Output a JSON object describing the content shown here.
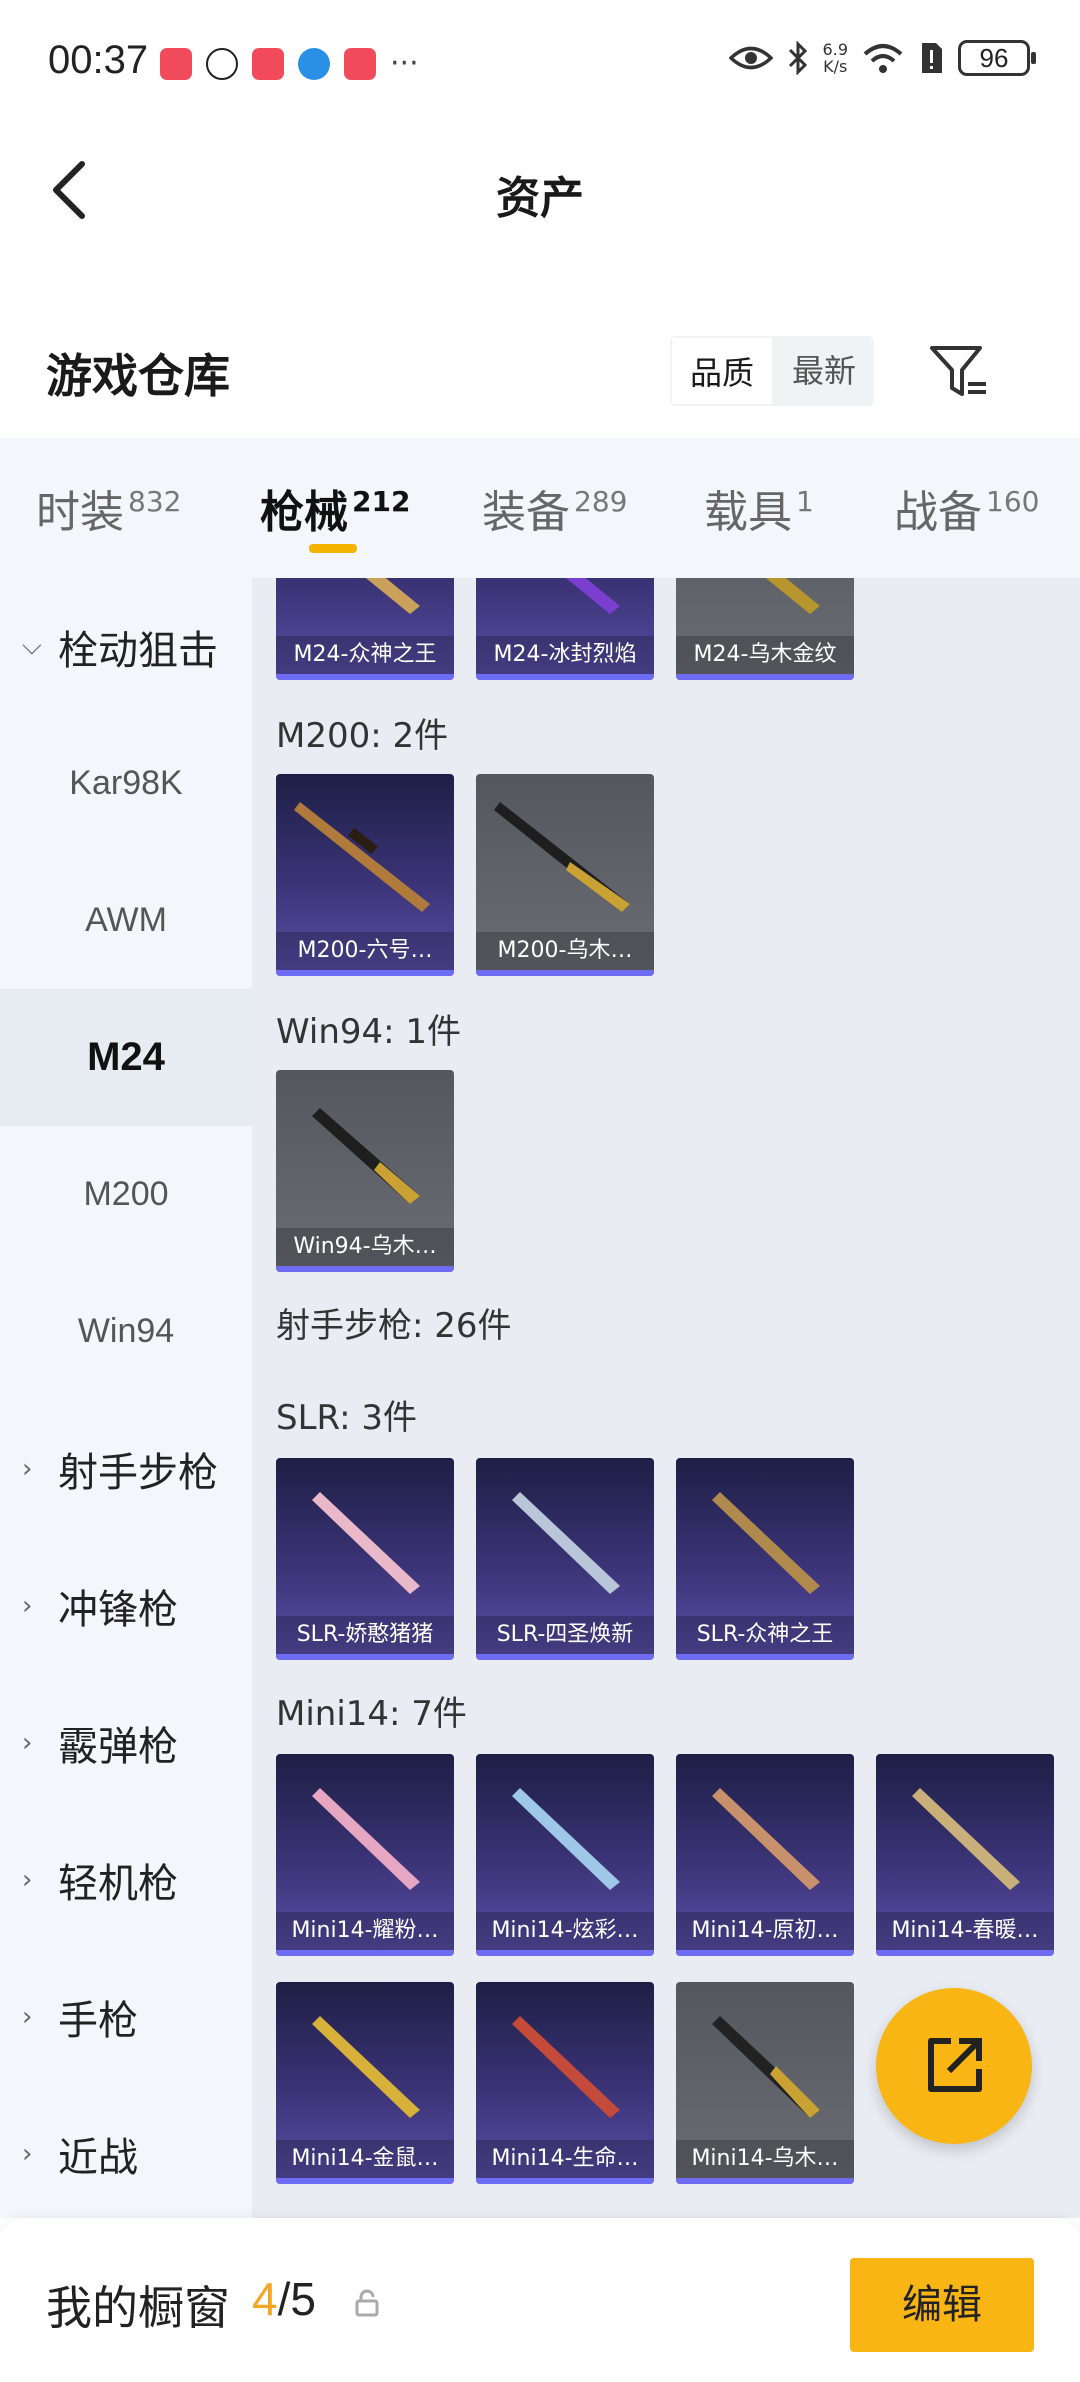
{
  "status_bar": {
    "time": "00:37",
    "more": "···",
    "speed_top": "6.9",
    "speed_bottom": "K/s",
    "battery": "96"
  },
  "header": {
    "title": "资产"
  },
  "warehouse": {
    "title": "游戏仓库",
    "sort_options": [
      "品质",
      "最新"
    ]
  },
  "category_tabs": [
    {
      "label": "时装",
      "count": "832"
    },
    {
      "label": "枪械",
      "count": "212"
    },
    {
      "label": "装备",
      "count": "289"
    },
    {
      "label": "载具",
      "count": "1"
    },
    {
      "label": "战备",
      "count": "160"
    }
  ],
  "sidebar": {
    "items": [
      {
        "label": "栓动狙击",
        "type": "group",
        "expanded": true
      },
      {
        "label": "Kar98K",
        "type": "sub"
      },
      {
        "label": "AWM",
        "type": "sub"
      },
      {
        "label": "M24",
        "type": "sub",
        "active": true
      },
      {
        "label": "M200",
        "type": "sub"
      },
      {
        "label": "Win94",
        "type": "sub"
      },
      {
        "label": "射手步枪",
        "type": "group"
      },
      {
        "label": "冲锋枪",
        "type": "group"
      },
      {
        "label": "霰弹枪",
        "type": "group"
      },
      {
        "label": "轻机枪",
        "type": "group"
      },
      {
        "label": "手枪",
        "type": "group"
      },
      {
        "label": "近战",
        "type": "group"
      }
    ]
  },
  "content": {
    "top_cards": [
      "M24-众神之王",
      "M24-冰封烈焰",
      "M24-乌木金纹"
    ],
    "sections": [
      {
        "label": "M200: 2件",
        "cards": [
          "M200-六号…",
          "M200-乌木…"
        ]
      },
      {
        "label": "Win94: 1件",
        "cards": [
          "Win94-乌木…"
        ]
      },
      {
        "label": "射手步枪: 26件"
      },
      {
        "label": "SLR: 3件",
        "cards": [
          "SLR-娇憨猪猪",
          "SLR-四圣焕新",
          "SLR-众神之王"
        ]
      },
      {
        "label": "Mini14: 7件",
        "cards": [
          "Mini14-耀粉…",
          "Mini14-炫彩…",
          "Mini14-原初…",
          "Mini14-春暖…",
          "Mini14-金鼠…",
          "Mini14-生命…",
          "Mini14-乌木…"
        ]
      }
    ]
  },
  "bottom_bar": {
    "title": "我的橱窗",
    "current": "4",
    "separator": "/",
    "max": "5",
    "edit_label": "编辑"
  },
  "colors": {
    "accent": "#f8b514",
    "card_purple": "#3c3478",
    "card_grey": "#60626a",
    "card_bar": "#6d6cf2"
  }
}
